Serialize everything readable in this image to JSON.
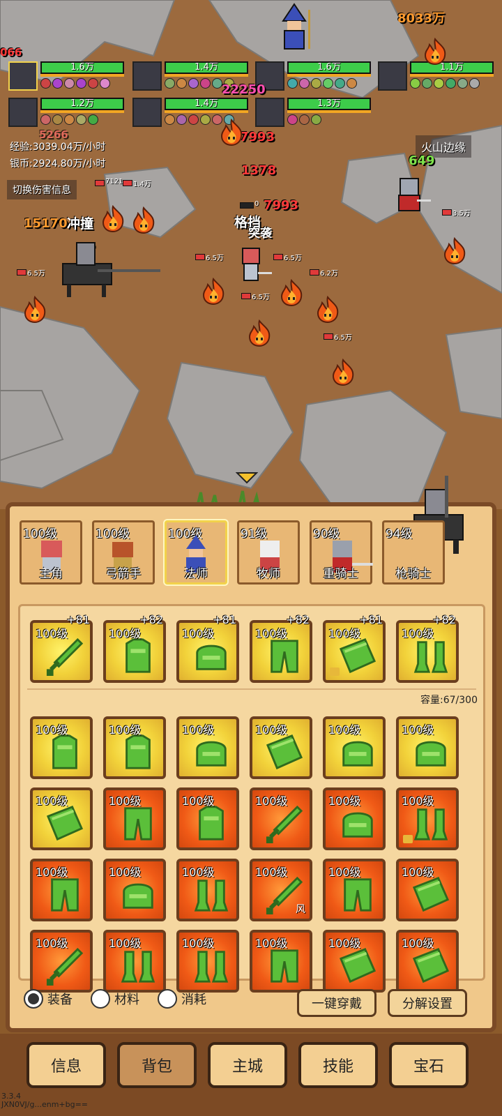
{
  "battle": {
    "party": [
      {
        "hp": "1.6万",
        "selected": true
      },
      {
        "hp": "1.4万",
        "selected": false
      },
      {
        "hp": "1.6万",
        "selected": false
      },
      {
        "hp": "1.1万",
        "selected": false
      },
      {
        "hp": "1.2万",
        "selected": false
      },
      {
        "hp": "1.4万",
        "selected": false
      },
      {
        "hp": "1.3万",
        "selected": false
      }
    ],
    "exp_rate": "经验:3039.04万/小时",
    "silver_rate": "银币:2924.80万/小时",
    "toggle_damage_label": "切换伤害信息",
    "zone_name": "火山边缘",
    "damage_numbers": [
      "8033万",
      "22250",
      "7993",
      "1378",
      "7993",
      "649",
      "15170",
      "066",
      "5266"
    ],
    "skill_texts": [
      "冲撞",
      "格挡",
      "突袭"
    ],
    "enemy_hp_labels": [
      "7121",
      "1.4万",
      "6.5万",
      "6.5万",
      "6.5万",
      "6.5万",
      "6.2万",
      "6.5万",
      "3.5万",
      "0",
      "0"
    ]
  },
  "heroes": [
    {
      "level": "100级",
      "name": "主角"
    },
    {
      "level": "100级",
      "name": "弓箭手"
    },
    {
      "level": "100级",
      "name": "法师",
      "selected": true
    },
    {
      "level": "91级",
      "name": "牧师"
    },
    {
      "level": "90级",
      "name": "重骑士"
    },
    {
      "level": "94级",
      "name": "枪骑士"
    }
  ],
  "equipped": [
    {
      "level": "100级",
      "plus": "+81",
      "item": "sword",
      "rarity": "yellow"
    },
    {
      "level": "100级",
      "plus": "+82",
      "item": "armor",
      "rarity": "yellow"
    },
    {
      "level": "100级",
      "plus": "+81",
      "item": "helmet",
      "rarity": "yellow"
    },
    {
      "level": "100级",
      "plus": "+82",
      "item": "pants",
      "rarity": "yellow"
    },
    {
      "level": "100级",
      "plus": "+81",
      "item": "bracer",
      "rarity": "yellow",
      "locked": true
    },
    {
      "level": "100级",
      "plus": "+82",
      "item": "boots",
      "rarity": "yellow"
    }
  ],
  "capacity": "容量:67/300",
  "bag": [
    {
      "level": "100级",
      "item": "armor",
      "rarity": "yellow"
    },
    {
      "level": "100级",
      "item": "armor",
      "rarity": "yellow"
    },
    {
      "level": "100级",
      "item": "helmet",
      "rarity": "yellow"
    },
    {
      "level": "100级",
      "item": "bracer",
      "rarity": "yellow"
    },
    {
      "level": "100级",
      "item": "helmet",
      "rarity": "yellow"
    },
    {
      "level": "100级",
      "item": "helmet",
      "rarity": "yellow"
    },
    {
      "level": "100级",
      "item": "bracer",
      "rarity": "yellow"
    },
    {
      "level": "100级",
      "item": "pants",
      "rarity": "orange"
    },
    {
      "level": "100级",
      "item": "armor",
      "rarity": "orange"
    },
    {
      "level": "100级",
      "item": "sword",
      "rarity": "orange"
    },
    {
      "level": "100级",
      "item": "helmet",
      "rarity": "orange"
    },
    {
      "level": "100级",
      "item": "boots",
      "rarity": "orange",
      "locked": true
    },
    {
      "level": "100级",
      "item": "pants",
      "rarity": "orange"
    },
    {
      "level": "100级",
      "item": "helmet",
      "rarity": "orange"
    },
    {
      "level": "100级",
      "item": "boots",
      "rarity": "orange"
    },
    {
      "level": "100级",
      "item": "sword",
      "rarity": "orange",
      "tag": "风"
    },
    {
      "level": "100级",
      "item": "pants",
      "rarity": "orange"
    },
    {
      "level": "100级",
      "item": "bracer",
      "rarity": "orange"
    },
    {
      "level": "100级",
      "item": "sword",
      "rarity": "orange"
    },
    {
      "level": "100级",
      "item": "boots",
      "rarity": "orange"
    },
    {
      "level": "100级",
      "item": "boots",
      "rarity": "orange"
    },
    {
      "level": "100级",
      "item": "pants",
      "rarity": "orange"
    },
    {
      "level": "100级",
      "item": "bracer",
      "rarity": "orange"
    },
    {
      "level": "100级",
      "item": "bracer",
      "rarity": "orange"
    }
  ],
  "filters": [
    {
      "label": "装备",
      "checked": true
    },
    {
      "label": "材料",
      "checked": false
    },
    {
      "label": "消耗",
      "checked": false
    }
  ],
  "actions": {
    "equip_all": "一键穿戴",
    "decompose_settings": "分解设置"
  },
  "nav": [
    {
      "label": "信息",
      "active": false
    },
    {
      "label": "背包",
      "active": true
    },
    {
      "label": "主城",
      "active": false
    },
    {
      "label": "技能",
      "active": false
    },
    {
      "label": "宝石",
      "active": false
    }
  ],
  "version": "3.3.4",
  "device_id": "JXN0VJ/g...enm+bg=="
}
